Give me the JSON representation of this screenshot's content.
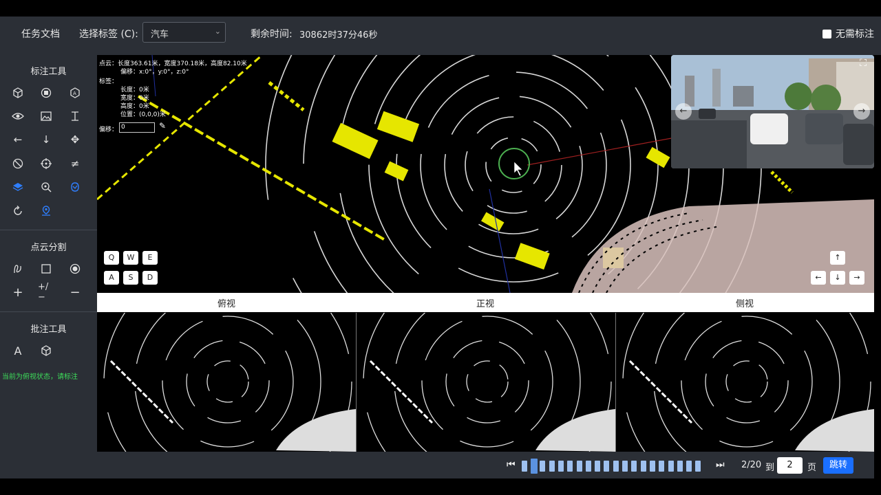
{
  "header": {
    "task_doc": "任务文档",
    "select_label_caption": "选择标签 (C):",
    "selected_label": "汽车",
    "remaining_time_caption": "剩余时间:",
    "remaining_time_value": "30862时37分46秒",
    "no_label_needed": "无需标注"
  },
  "sidebar": {
    "annotation_tools_title": "标注工具",
    "segmentation_title": "点云分割",
    "comment_tools_title": "批注工具",
    "status_hint": "当前为俯视状态，请标注"
  },
  "pointcloud_info": {
    "cloud_line": "点云：长度363.61米，宽度370.18米，高度82.10米",
    "rotation_line": "偏移：x:0°，y:0°，z:0°",
    "label_caption": "标签：",
    "length": "长度：0米",
    "width": "宽度：0米",
    "height": "高度：0米",
    "position": "位置：(0,0,0)米",
    "offset_caption": "偏移：",
    "offset_value": "0"
  },
  "keys": [
    "Q",
    "W",
    "E",
    "A",
    "S",
    "D"
  ],
  "arrow_keys": {
    "up": "↑",
    "left": "←",
    "down": "↓",
    "right": "→"
  },
  "views": {
    "top": "俯视",
    "front": "正视",
    "side": "侧视"
  },
  "pagination": {
    "current_of_total": "2/20",
    "to_caption": "到",
    "page_value": "2",
    "page_suffix": "页",
    "jump_button": "跳转",
    "current_segment": 2,
    "total_segments": 20
  },
  "colors": {
    "panel_bg": "#2b2f36",
    "accent_blue": "#1a6fff",
    "status_green": "#3ddc5a",
    "point_yellow": "#e6e600",
    "point_pink": "#d9c2bd"
  }
}
